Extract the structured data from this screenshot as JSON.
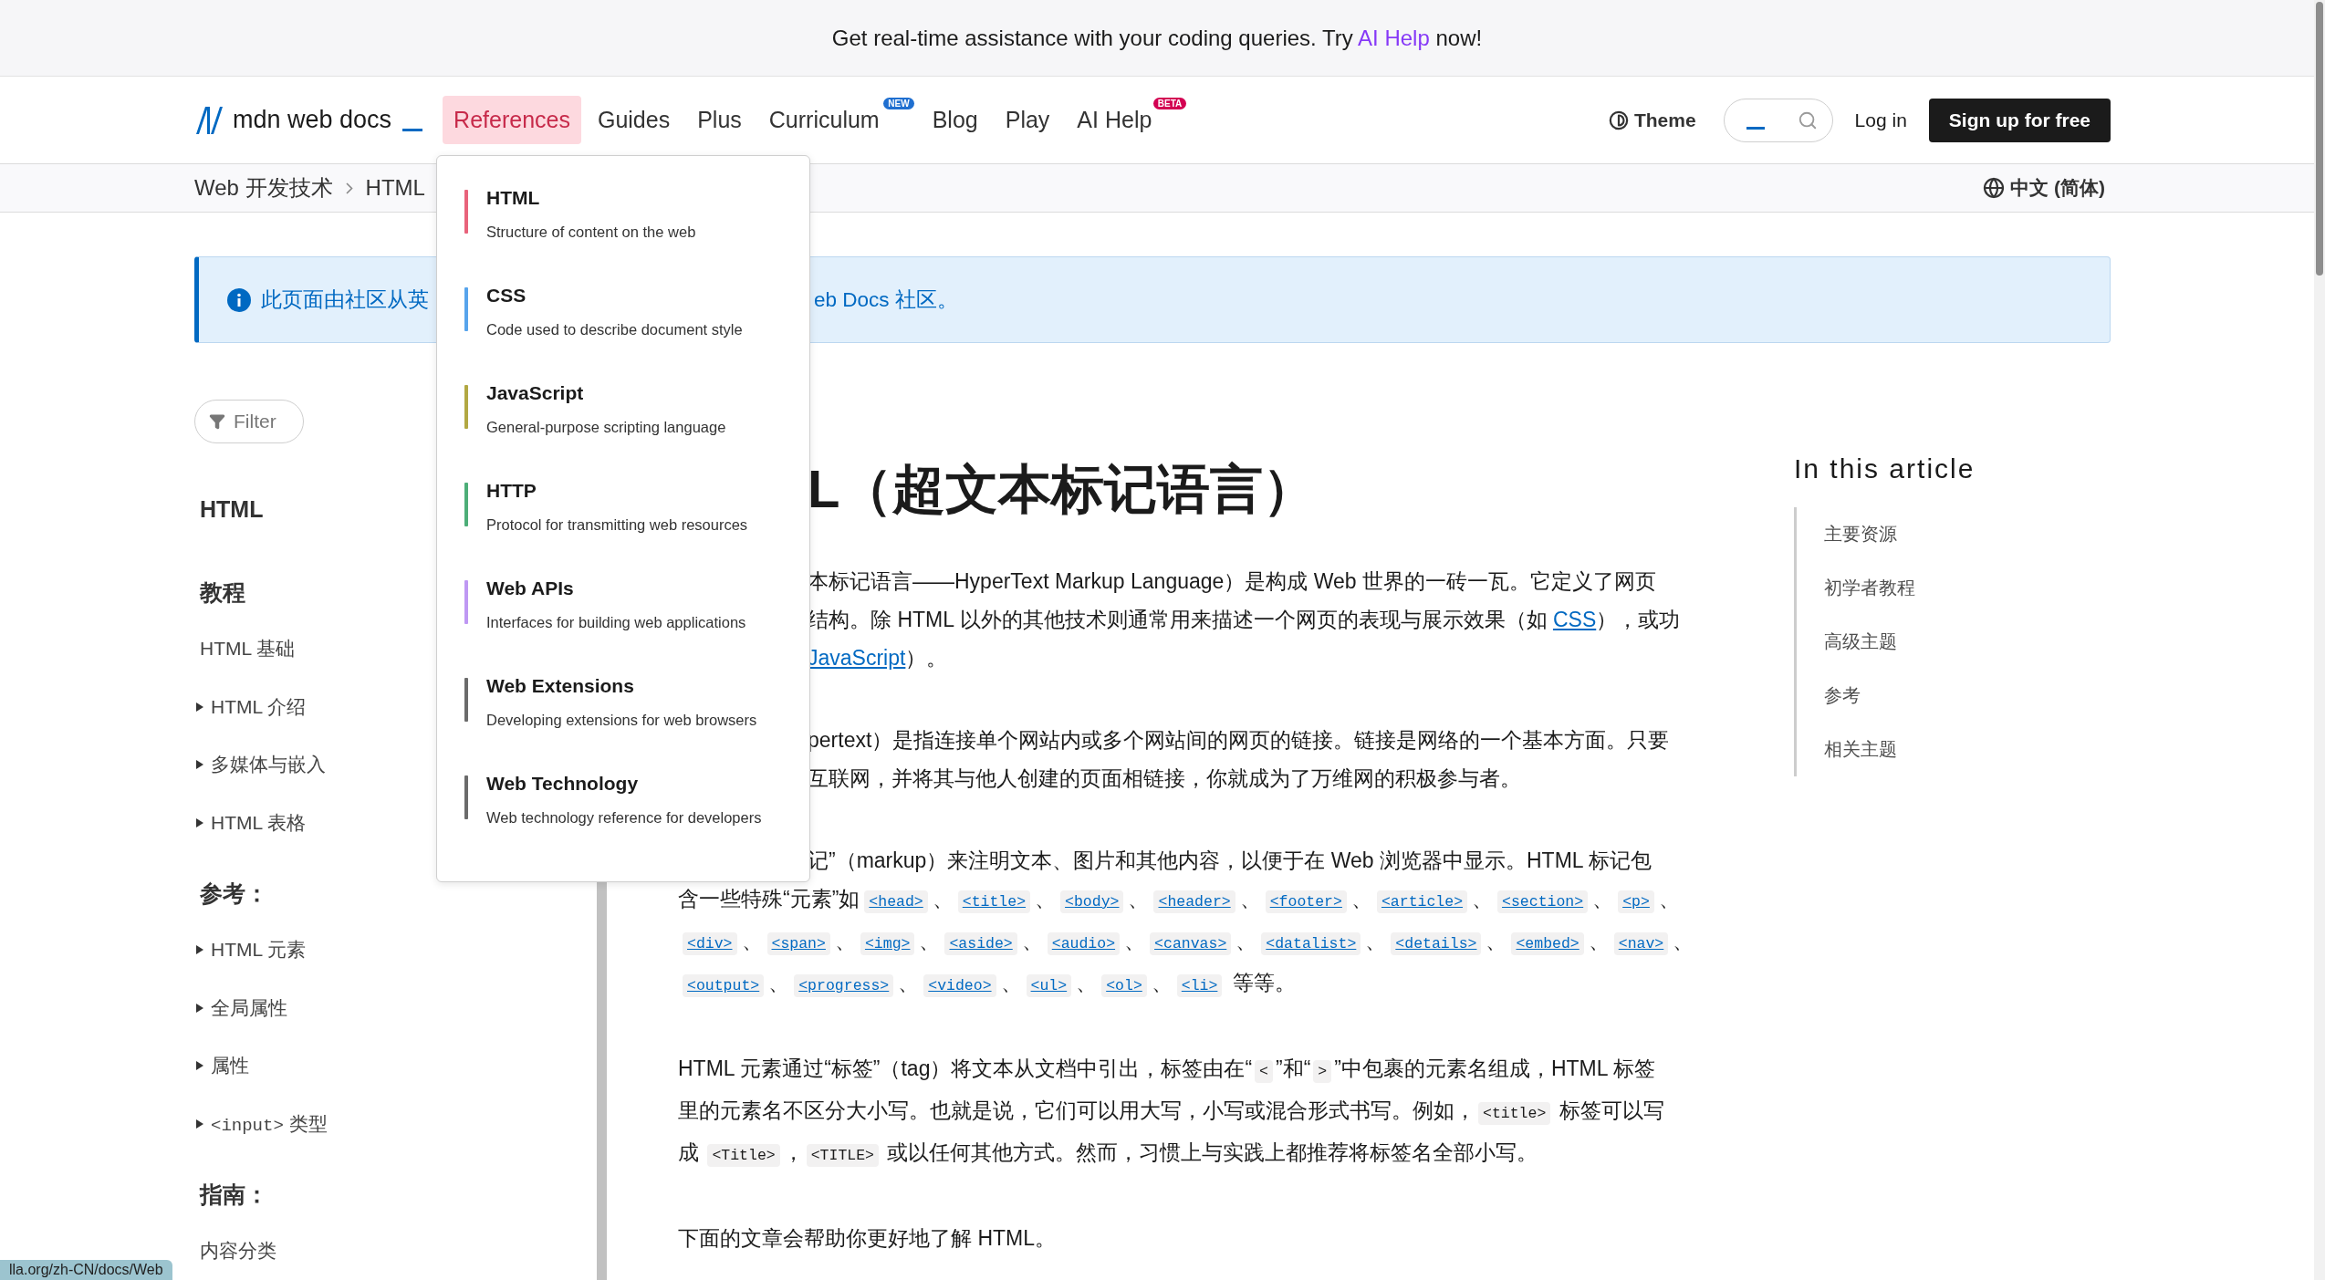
{
  "banner": {
    "text": "Get real-time assistance with your coding queries. Try ",
    "link": "AI Help",
    "text_after": " now!"
  },
  "header": {
    "logo": "mdn web docs",
    "nav": [
      {
        "label": "References",
        "selected": true
      },
      {
        "label": "Guides",
        "selected": false
      },
      {
        "label": "Plus",
        "selected": false
      },
      {
        "label": "Curriculum",
        "selected": false,
        "badge": {
          "text": "NEW",
          "color": "#1f6fd0"
        }
      },
      {
        "label": "Blog",
        "selected": false
      },
      {
        "label": "Play",
        "selected": false
      },
      {
        "label": "AI Help",
        "selected": false,
        "badge": {
          "text": "BETA",
          "color": "#d30052"
        }
      }
    ],
    "theme": "Theme",
    "login": "Log in",
    "signup": "Sign up for free"
  },
  "menu": {
    "items": [
      {
        "title": "HTML",
        "description": "Structure of content on the web",
        "color": "#e8637b"
      },
      {
        "title": "CSS",
        "description": "Code used to describe document style",
        "color": "#57a4ec"
      },
      {
        "title": "JavaScript",
        "description": "General-purpose scripting language",
        "color": "#b2a843"
      },
      {
        "title": "HTTP",
        "description": "Protocol for transmitting web resources",
        "color": "#4dae78"
      },
      {
        "title": "Web APIs",
        "description": "Interfaces for building web applications",
        "color": "#bf98f3"
      },
      {
        "title": "Web Extensions",
        "description": "Developing extensions for web browsers",
        "color": "#6b6b6b"
      },
      {
        "title": "Web Technology",
        "description": "Web technology reference for developers",
        "color": "#6b6b6b"
      }
    ]
  },
  "breadcrumb": {
    "items": [
      "Web 开发技术",
      "HTML"
    ],
    "language": "中文 (简体)"
  },
  "notice": {
    "parts": [
      "此页面由社区从英",
      "eb Docs 社区。"
    ]
  },
  "sidebar": {
    "filter_placeholder": "Filter",
    "items": [
      {
        "kind": "title",
        "label": "HTML"
      },
      {
        "kind": "heading",
        "label": "教程"
      },
      {
        "kind": "link",
        "label": "HTML 基础"
      },
      {
        "kind": "group",
        "label": "HTML 介绍",
        "expanded": false
      },
      {
        "kind": "group",
        "label": "多媒体与嵌入",
        "expanded": false
      },
      {
        "kind": "group",
        "label": "HTML 表格",
        "expanded": false
      },
      {
        "kind": "heading",
        "label": "参考："
      },
      {
        "kind": "group",
        "label": "HTML 元素",
        "expanded": false
      },
      {
        "kind": "group",
        "label": "全局属性",
        "expanded": false
      },
      {
        "kind": "group",
        "label": "属性",
        "expanded": false
      },
      {
        "kind": "group",
        "code": "<input>",
        "label": "类型",
        "expanded": false
      },
      {
        "kind": "heading",
        "label": "指南："
      },
      {
        "kind": "link",
        "label": "内容分类"
      }
    ]
  },
  "article": {
    "title": {
      "text": "L（超文本标记语言）",
      "cut": true
    },
    "paragraphs": [
      {
        "lines": [
          {
            "cut": true,
            "segments": [
              {
                "kind": "text",
                "text": "本标记语言——HyperText Markup Language）是构成 Web 世界的一砖一瓦。它定义了网页"
              }
            ]
          },
          {
            "cut": true,
            "segments": [
              {
                "kind": "text",
                "text": "结构。除 HTML 以外的其他技术则通常用来描述一个网页的表现与展示效果（如 "
              },
              {
                "kind": "link",
                "text": "CSS"
              },
              {
                "kind": "text",
                "text": "），或功"
              }
            ]
          },
          {
            "cut": true,
            "segments": [
              {
                "kind": "link",
                "text": "JavaScript"
              },
              {
                "kind": "text",
                "text": "）。"
              }
            ]
          }
        ]
      },
      {
        "lines": [
          {
            "cut": true,
            "segments": [
              {
                "kind": "text",
                "text": "pertext）是指连接单个网站内或多个网站间的网页的链接。链接是网络的一个基本方面。只要"
              }
            ]
          },
          {
            "cut": true,
            "segments": [
              {
                "kind": "text",
                "text": "互联网，并将其与他人创建的页面相链接，你就成为了万维网的积极参与者。"
              }
            ]
          }
        ]
      },
      {
        "lines": [
          {
            "cut": true,
            "segments": [
              {
                "kind": "text",
                "text": "记”（markup）来注明文本、图片和其他内容，以便于在 Web 浏览器中显示。HTML 标记包"
              }
            ]
          },
          {
            "cut": false,
            "segments": [
              {
                "kind": "text",
                "text": "含一些特殊“元素”如"
              },
              {
                "kind": "code_link",
                "text": "<head>"
              },
              {
                "kind": "text",
                "text": "、"
              },
              {
                "kind": "code_link",
                "text": "<title>"
              },
              {
                "kind": "text",
                "text": "、"
              },
              {
                "kind": "code_link",
                "text": "<body>"
              },
              {
                "kind": "text",
                "text": "、"
              },
              {
                "kind": "code_link",
                "text": "<header>"
              },
              {
                "kind": "text",
                "text": "、"
              },
              {
                "kind": "code_link",
                "text": "<footer>"
              },
              {
                "kind": "text",
                "text": "、"
              },
              {
                "kind": "code_link",
                "text": "<article>"
              },
              {
                "kind": "text",
                "text": "、"
              },
              {
                "kind": "code_link",
                "text": "<section>"
              },
              {
                "kind": "text",
                "text": "、"
              },
              {
                "kind": "code_link",
                "text": "<p>"
              },
              {
                "kind": "text",
                "text": "、"
              }
            ]
          },
          {
            "cut": false,
            "segments": [
              {
                "kind": "code_link",
                "text": "<div>"
              },
              {
                "kind": "text",
                "text": "、"
              },
              {
                "kind": "code_link",
                "text": "<span>"
              },
              {
                "kind": "text",
                "text": "、"
              },
              {
                "kind": "code_link",
                "text": "<img>"
              },
              {
                "kind": "text",
                "text": "、"
              },
              {
                "kind": "code_link",
                "text": "<aside>"
              },
              {
                "kind": "text",
                "text": "、"
              },
              {
                "kind": "code_link",
                "text": "<audio>"
              },
              {
                "kind": "text",
                "text": "、"
              },
              {
                "kind": "code_link",
                "text": "<canvas>"
              },
              {
                "kind": "text",
                "text": "、"
              },
              {
                "kind": "code_link",
                "text": "<datalist>"
              },
              {
                "kind": "text",
                "text": "、"
              },
              {
                "kind": "code_link",
                "text": "<details>"
              },
              {
                "kind": "text",
                "text": "、"
              },
              {
                "kind": "code_link",
                "text": "<embed>"
              },
              {
                "kind": "text",
                "text": "、"
              },
              {
                "kind": "code_link",
                "text": "<nav>"
              },
              {
                "kind": "text",
                "text": "、"
              }
            ]
          },
          {
            "cut": false,
            "segments": [
              {
                "kind": "code_link",
                "text": "<output>"
              },
              {
                "kind": "text",
                "text": "、"
              },
              {
                "kind": "code_link",
                "text": "<progress>"
              },
              {
                "kind": "text",
                "text": "、"
              },
              {
                "kind": "code_link",
                "text": "<video>"
              },
              {
                "kind": "text",
                "text": "、"
              },
              {
                "kind": "code_link",
                "text": "<ul>"
              },
              {
                "kind": "text",
                "text": "、"
              },
              {
                "kind": "code_link",
                "text": "<ol>"
              },
              {
                "kind": "text",
                "text": "、"
              },
              {
                "kind": "code_link",
                "text": "<li>"
              },
              {
                "kind": "text",
                "text": " 等等。"
              }
            ]
          }
        ]
      },
      {
        "lines": [
          {
            "cut": false,
            "segments": [
              {
                "kind": "text",
                "text": "HTML 元素通过“标签”（tag）将文本从文档中引出，标签由在“"
              },
              {
                "kind": "code",
                "text": "<"
              },
              {
                "kind": "text",
                "text": "”和“"
              },
              {
                "kind": "code",
                "text": ">"
              },
              {
                "kind": "text",
                "text": "”中包裹的元素名组成，HTML 标签"
              }
            ]
          },
          {
            "cut": false,
            "segments": [
              {
                "kind": "text",
                "text": "里的元素名不区分大小写。也就是说，它们可以用大写，小写或混合形式书写。例如，"
              },
              {
                "kind": "code",
                "text": "<title>"
              },
              {
                "kind": "text",
                "text": " 标签可以写"
              }
            ]
          },
          {
            "cut": false,
            "segments": [
              {
                "kind": "text",
                "text": "成 "
              },
              {
                "kind": "code",
                "text": "<Title>"
              },
              {
                "kind": "text",
                "text": "，"
              },
              {
                "kind": "code",
                "text": "<TITLE>"
              },
              {
                "kind": "text",
                "text": " 或以任何其他方式。然而，习惯上与实践上都推荐将标签名全部小写。"
              }
            ]
          }
        ]
      },
      {
        "lines": [
          {
            "cut": false,
            "segments": [
              {
                "kind": "text",
                "text": "下面的文章会帮助你更好地了解 HTML。"
              }
            ]
          }
        ]
      }
    ]
  },
  "toc": {
    "title": "In this article",
    "items": [
      "主要资源",
      "初学者教程",
      "高级主题",
      "参考",
      "相关主题"
    ]
  },
  "status_link": "lla.org/zh-CN/docs/Web"
}
